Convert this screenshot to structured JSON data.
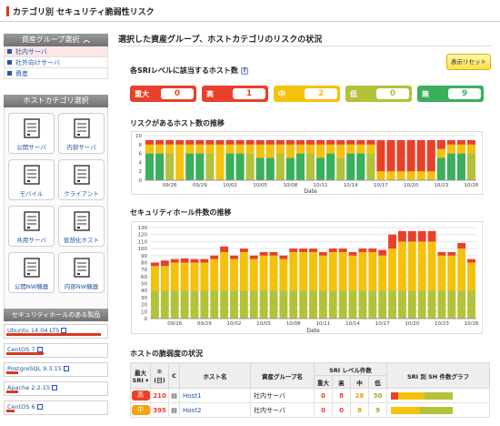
{
  "title": "カテゴリ別 セキュリティ脆弱性リスク",
  "sidebar": {
    "group_header": "資産グループ選択",
    "groups": [
      {
        "label": "社内サーバ",
        "selected": true
      },
      {
        "label": "社外向けサーバ",
        "selected": false
      },
      {
        "label": "資産",
        "selected": false
      }
    ],
    "category_header": "ホストカテゴリ選択",
    "categories": [
      {
        "label": "公開サーバ",
        "icon": "public-server-icon"
      },
      {
        "label": "内部サーバ",
        "icon": "internal-server-icon"
      },
      {
        "label": "モバイル",
        "icon": "mobile-icon"
      },
      {
        "label": "クライアント",
        "icon": "client-icon"
      },
      {
        "label": "共用サーバ",
        "icon": "shared-server-icon"
      },
      {
        "label": "仮想化ホスト",
        "icon": "virtual-host-icon"
      },
      {
        "label": "公開NW機器",
        "icon": "public-network-icon"
      },
      {
        "label": "内部NW機器",
        "icon": "internal-network-icon"
      }
    ],
    "products_header": "セキュリティホールのある製品",
    "products": [
      {
        "name": "Ubuntu 14.04 LTS",
        "bar": 0.95
      },
      {
        "name": "CentOS 7",
        "bar": 0.38
      },
      {
        "name": "PostgreSQL 9.3.15",
        "bar": 0.12
      },
      {
        "name": "Apache 2.2.15",
        "bar": 0.12
      },
      {
        "name": "CentOS 6",
        "bar": 0.08
      }
    ]
  },
  "main": {
    "heading": "選択した資産グループ、ホストカテゴリのリスクの状況",
    "reset_label": "表示リセット",
    "sri_title": "各SRIレベルに該当するホスト数",
    "help_glyph": "?",
    "sri": [
      {
        "label": "重大",
        "count": "0",
        "color": "#e8402a"
      },
      {
        "label": "高",
        "count": "1",
        "color": "#e8402a"
      },
      {
        "label": "中",
        "count": "2",
        "color": "#f4c20d"
      },
      {
        "label": "低",
        "count": "0",
        "color": "#b3c23a"
      },
      {
        "label": "無",
        "count": "9",
        "color": "#3aaf5c"
      }
    ],
    "chart1_title": "リスクがあるホスト数の推移",
    "chart2_title": "セキュリティホール件数の推移",
    "table_title": "ホストの脆弱度の状況",
    "table": {
      "headers": {
        "sri": "最大 SRI ▾",
        "days": "(日)",
        "c": "C",
        "host": "ホスト名",
        "group": "資産グループ名",
        "level": "SRI レベル件数",
        "graph": "SRI 別 SH 件数グラフ"
      },
      "level_headers": [
        "重大",
        "高",
        "中",
        "低"
      ],
      "rows": [
        {
          "sri": "高",
          "sri_color": "#e8402a",
          "days": "210",
          "days_color": "#e8402a",
          "host": "Host1",
          "group": "社内サーバ",
          "counts": [
            "0",
            "8",
            "28",
            "30"
          ],
          "bars": [
            0,
            0.12,
            0.42,
            0.46
          ]
        },
        {
          "sri": "中",
          "sri_color": "#f4a20d",
          "days": "395",
          "days_color": "#e8402a",
          "host": "Host2",
          "group": "社内サーバ",
          "counts": [
            "0",
            "0",
            "8",
            "9"
          ],
          "bars": [
            0,
            0,
            0.47,
            0.53
          ]
        }
      ]
    }
  },
  "chart_data": [
    {
      "type": "bar",
      "title": "リスクがあるホスト数の推移",
      "xlabel": "Date",
      "ylim": [
        0,
        10
      ],
      "yticks": [
        0,
        2,
        4,
        6,
        8,
        10
      ],
      "x": [
        "09/24",
        "09/25",
        "09/26",
        "09/27",
        "09/28",
        "09/29",
        "09/30",
        "10/01",
        "10/02",
        "10/03",
        "10/04",
        "10/05",
        "10/06",
        "10/07",
        "10/08",
        "10/09",
        "10/10",
        "10/11",
        "10/12",
        "10/13",
        "10/14",
        "10/15",
        "10/16",
        "10/17",
        "10/18",
        "10/19",
        "10/20",
        "10/21",
        "10/22",
        "10/23",
        "10/24",
        "10/25",
        "10/26"
      ],
      "xticklabels": [
        "09/26",
        "09/29",
        "10/02",
        "10/05",
        "10/08",
        "10/11",
        "10/14",
        "10/17",
        "10/20",
        "10/23",
        "10/26"
      ],
      "series": [
        {
          "name": "無",
          "color": "#3aaf5c",
          "values": [
            6,
            6,
            0,
            0,
            6,
            6,
            0,
            0,
            6,
            6,
            0,
            5,
            5,
            0,
            5,
            6,
            0,
            5,
            6,
            0,
            6,
            6,
            0,
            0,
            0,
            0,
            0,
            0,
            0,
            5,
            6,
            6,
            0
          ]
        },
        {
          "name": "低",
          "color": "#b3c23a",
          "values": [
            0,
            0,
            6,
            0,
            0,
            0,
            6,
            0,
            0,
            0,
            6,
            0,
            0,
            6,
            0,
            0,
            6,
            0,
            0,
            5,
            0,
            0,
            6,
            0,
            0,
            0,
            0,
            0,
            0,
            0,
            0,
            0,
            6
          ]
        },
        {
          "name": "中",
          "color": "#f4c20d",
          "values": [
            2,
            2,
            2,
            8,
            2,
            2,
            2,
            8,
            2,
            2,
            2,
            3,
            3,
            2,
            3,
            2,
            2,
            3,
            2,
            3,
            2,
            2,
            2,
            2,
            2,
            2,
            2,
            2,
            2,
            2,
            2,
            2,
            2
          ]
        },
        {
          "name": "高",
          "color": "#e8402a",
          "values": [
            1,
            1,
            1,
            1,
            1,
            1,
            1,
            1,
            1,
            1,
            1,
            1,
            1,
            1,
            1,
            1,
            1,
            1,
            1,
            1,
            1,
            1,
            1,
            7,
            7,
            7,
            7,
            7,
            7,
            2,
            1,
            1,
            1
          ]
        }
      ]
    },
    {
      "type": "bar",
      "title": "セキュリティホール件数の推移",
      "xlabel": "Date",
      "ylim": [
        0,
        130
      ],
      "yticks": [
        0,
        10,
        20,
        30,
        40,
        50,
        60,
        70,
        80,
        90,
        100,
        110,
        120,
        130
      ],
      "x": [
        "09/24",
        "09/25",
        "09/26",
        "09/27",
        "09/28",
        "09/29",
        "09/30",
        "10/01",
        "10/02",
        "10/03",
        "10/04",
        "10/05",
        "10/06",
        "10/07",
        "10/08",
        "10/09",
        "10/10",
        "10/11",
        "10/12",
        "10/13",
        "10/14",
        "10/15",
        "10/16",
        "10/17",
        "10/18",
        "10/19",
        "10/20",
        "10/21",
        "10/22",
        "10/23",
        "10/24",
        "10/25",
        "10/26"
      ],
      "xticklabels": [
        "09/26",
        "09/29",
        "10/02",
        "10/05",
        "10/08",
        "10/11",
        "10/14",
        "10/17",
        "10/20",
        "10/23",
        "10/26"
      ],
      "series": [
        {
          "name": "低",
          "color": "#b3c23a",
          "values": [
            40,
            40,
            40,
            40,
            40,
            40,
            40,
            40,
            40,
            40,
            40,
            40,
            40,
            40,
            40,
            40,
            40,
            40,
            40,
            40,
            40,
            40,
            40,
            40,
            40,
            40,
            40,
            40,
            40,
            40,
            40,
            40,
            40
          ]
        },
        {
          "name": "中",
          "color": "#f4c20d",
          "values": [
            35,
            35,
            40,
            40,
            40,
            40,
            45,
            55,
            45,
            55,
            45,
            50,
            50,
            45,
            55,
            55,
            55,
            50,
            55,
            55,
            50,
            55,
            55,
            50,
            60,
            70,
            70,
            70,
            70,
            50,
            50,
            60,
            40
          ]
        },
        {
          "name": "高",
          "color": "#e8402a",
          "values": [
            5,
            8,
            5,
            6,
            5,
            5,
            5,
            8,
            5,
            5,
            5,
            5,
            5,
            5,
            5,
            5,
            5,
            5,
            5,
            5,
            5,
            5,
            5,
            8,
            20,
            15,
            15,
            15,
            15,
            5,
            5,
            8,
            5
          ]
        }
      ]
    }
  ]
}
